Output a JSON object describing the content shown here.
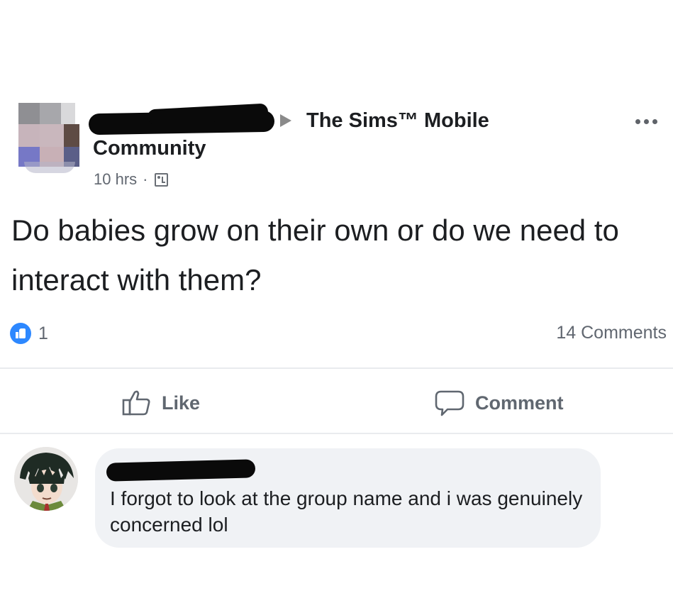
{
  "post": {
    "group_name_line1": "The Sims™ Mobile",
    "group_name_line2": "Community",
    "time": "10 hrs",
    "separator": "·",
    "text": "Do babies grow on their own or do we need to interact with them?",
    "like_count": "1",
    "comments_count": "14 Comments"
  },
  "actions": {
    "like_label": "Like",
    "comment_label": "Comment"
  },
  "comment": {
    "text": "I forgot to look at the group name and i was genuinely concerned lol"
  },
  "icons": {
    "more": "more-options-icon",
    "arrow": "right-arrow-icon",
    "privacy": "public-group-icon",
    "reaction": "like-reaction-icon",
    "like": "thumbs-up-icon",
    "comment": "speech-bubble-icon"
  },
  "colors": {
    "like_blue": "#2d88ff",
    "text": "#1c1e21",
    "secondary": "#616770",
    "bubble": "#f0f2f5"
  }
}
